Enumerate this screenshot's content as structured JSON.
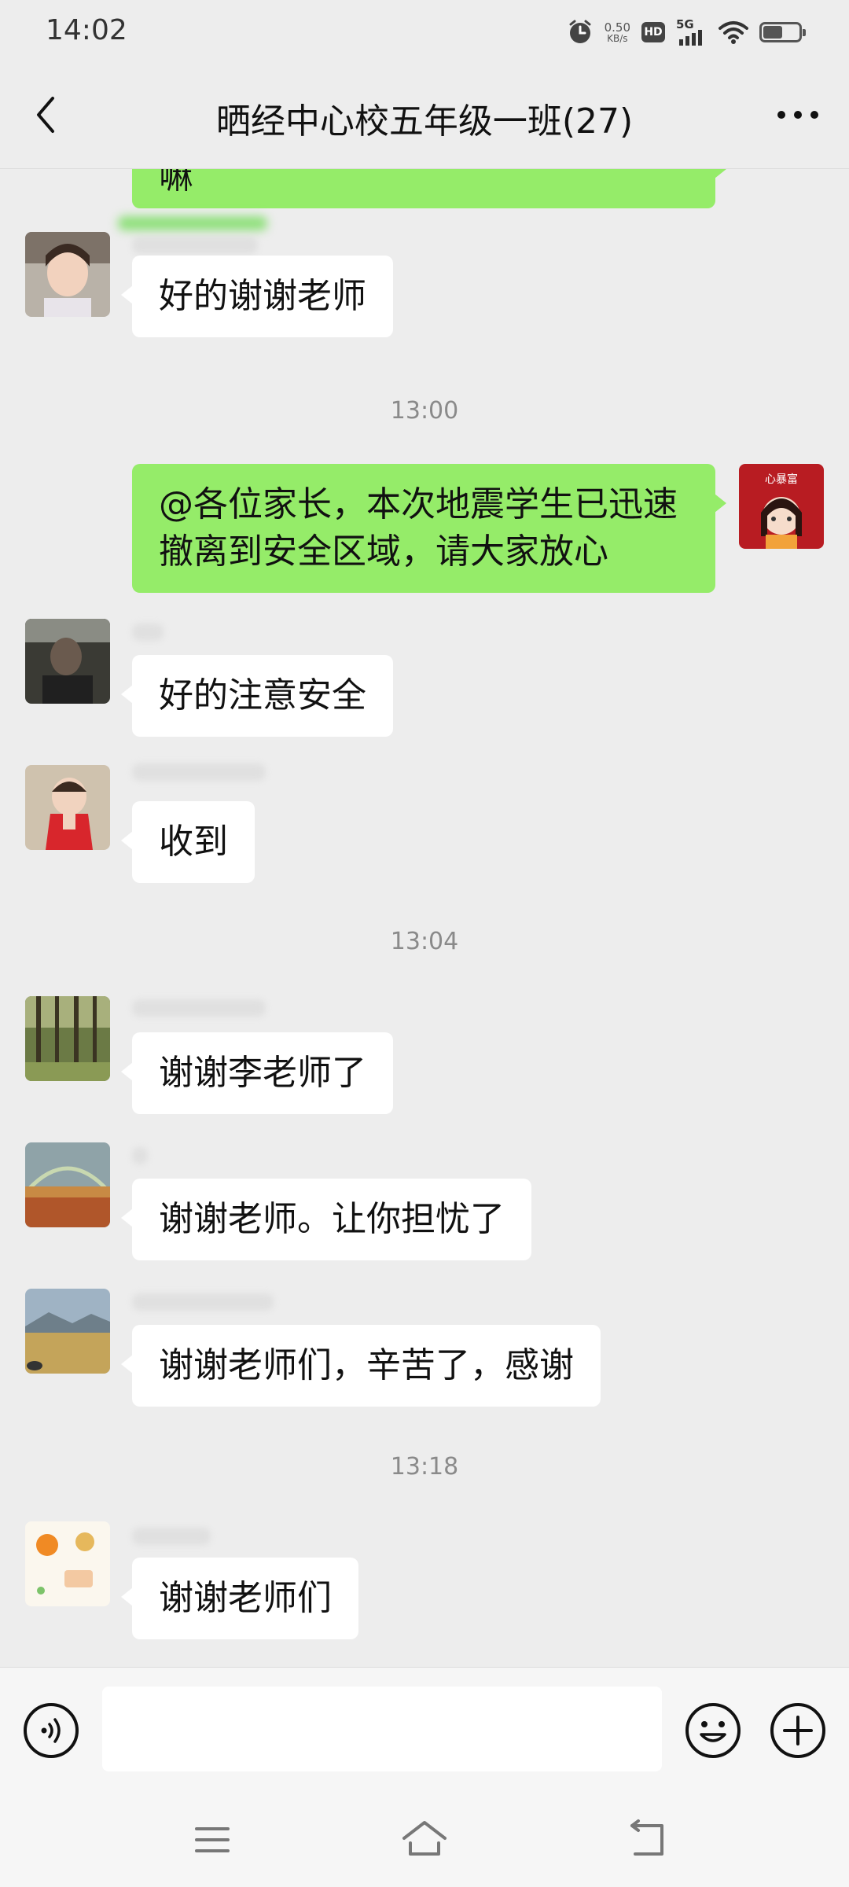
{
  "status_bar": {
    "time": "14:02",
    "net_speed_value": "0.50",
    "net_speed_unit": "KB/s",
    "hd_label": "HD",
    "network_label": "5G",
    "battery_level": 0.55
  },
  "header": {
    "title": "晒经中心校五年级一班(27)"
  },
  "chat": {
    "messages": [
      {
        "type": "out",
        "text": "嘛"
      },
      {
        "type": "in",
        "text": "好的谢谢老师"
      },
      {
        "type": "time",
        "text": "13:00"
      },
      {
        "type": "out",
        "text": "@各位家长，本次地震学生已迅速撤离到安全区域，请大家放心",
        "line1": "@各位家长，本次地震学生已迅速",
        "line2": "撤离到安全区域，请大家放心"
      },
      {
        "type": "in",
        "text": "好的注意安全"
      },
      {
        "type": "in",
        "text": "收到"
      },
      {
        "type": "time",
        "text": "13:04"
      },
      {
        "type": "in",
        "text": "谢谢李老师了"
      },
      {
        "type": "in",
        "text": "谢谢老师。让你担忧了"
      },
      {
        "type": "in",
        "text": "谢谢老师们，辛苦了，感谢"
      },
      {
        "type": "time",
        "text": "13:18"
      },
      {
        "type": "in",
        "text": "谢谢老师们"
      }
    ],
    "self_avatar_text": "心暴富"
  },
  "input_bar": {
    "placeholder": ""
  },
  "colors": {
    "background": "#ededed",
    "outgoing_bubble": "#95ec69",
    "incoming_bubble": "#ffffff",
    "timestamp": "#8a8a8a"
  },
  "icons": [
    "back-arrow-icon",
    "more-dots-icon",
    "voice-icon",
    "emoji-icon",
    "plus-icon",
    "menu-icon",
    "home-icon",
    "back-icon",
    "alarm-icon",
    "wifi-icon",
    "battery-icon"
  ]
}
